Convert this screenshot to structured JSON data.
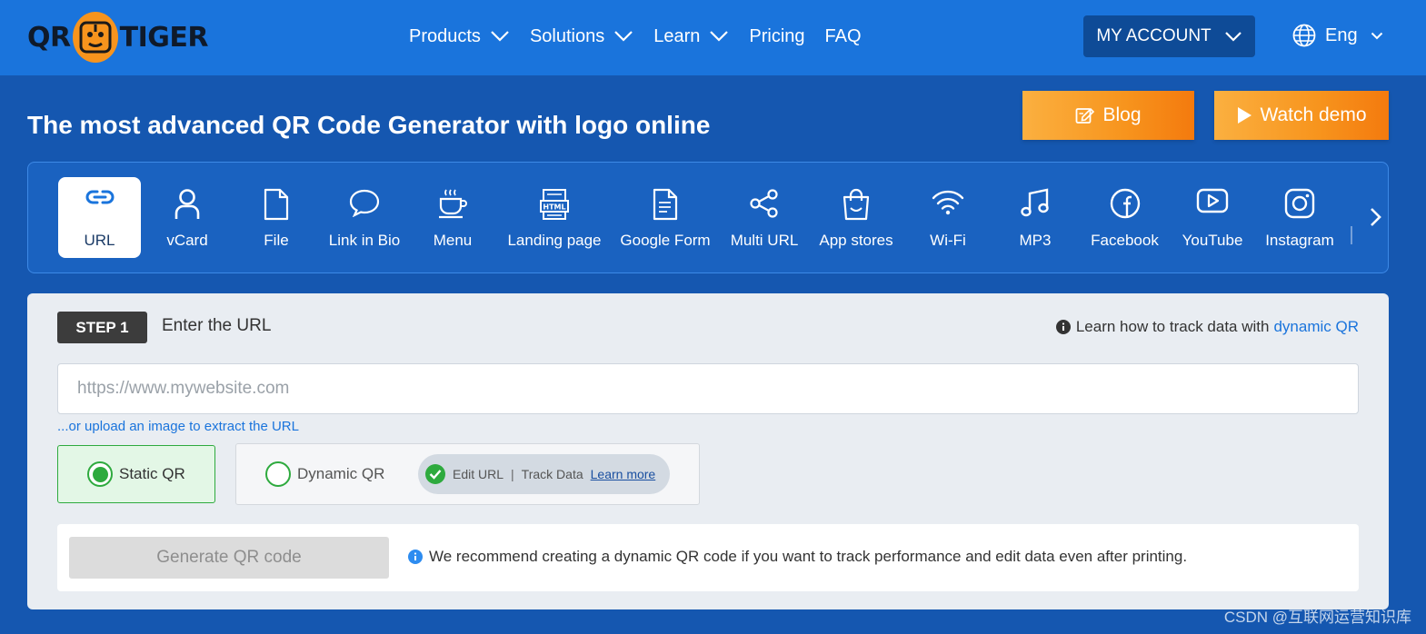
{
  "colors": {
    "nav_bg": "#1a74dc",
    "page_bg": "#1557b0",
    "accent_orange": "#f7941d",
    "success_green": "#2eaa3e"
  },
  "logo": {
    "text_left": "QR",
    "text_right": "TIGER",
    "badge_icon": "tiger-icon"
  },
  "nav": {
    "items": [
      {
        "label": "Products",
        "has_dropdown": true
      },
      {
        "label": "Solutions",
        "has_dropdown": true
      },
      {
        "label": "Learn",
        "has_dropdown": true
      },
      {
        "label": "Pricing",
        "has_dropdown": false
      },
      {
        "label": "FAQ",
        "has_dropdown": false
      }
    ],
    "account_label": "MY ACCOUNT",
    "language_label": "Eng"
  },
  "hero": {
    "title": "The most advanced QR Code Generator with logo online",
    "blog_label": "Blog",
    "demo_label": "Watch demo"
  },
  "qr_types": {
    "items": [
      {
        "label": "URL",
        "icon": "link-icon",
        "active": true
      },
      {
        "label": "vCard",
        "icon": "user-icon"
      },
      {
        "label": "File",
        "icon": "file-icon"
      },
      {
        "label": "Link in Bio",
        "icon": "chat-bubble-icon"
      },
      {
        "label": "Menu",
        "icon": "coffee-cup-icon"
      },
      {
        "label": "Landing page",
        "icon": "html-page-icon"
      },
      {
        "label": "Google Form",
        "icon": "document-icon"
      },
      {
        "label": "Multi URL",
        "icon": "share-icon"
      },
      {
        "label": "App stores",
        "icon": "shopping-bag-icon"
      },
      {
        "label": "Wi-Fi",
        "icon": "wifi-icon"
      },
      {
        "label": "MP3",
        "icon": "music-note-icon"
      },
      {
        "label": "Facebook",
        "icon": "facebook-icon"
      },
      {
        "label": "YouTube",
        "icon": "youtube-icon"
      },
      {
        "label": "Instagram",
        "icon": "instagram-icon"
      }
    ]
  },
  "step": {
    "badge": "STEP 1",
    "label": "Enter the URL",
    "track_text": "Learn how to track data with",
    "track_link": "dynamic QR"
  },
  "url_input": {
    "value": "",
    "placeholder": "https://www.mywebsite.com"
  },
  "upload_link": "...or upload an image to extract the URL",
  "options": {
    "static_label": "Static QR",
    "dynamic_label": "Dynamic QR",
    "dynamic_pill": {
      "edit": "Edit URL",
      "sep": "|",
      "track": "Track Data",
      "learn": "Learn more"
    },
    "selected": "static"
  },
  "generate": {
    "button_label": "Generate QR code",
    "note": "We recommend creating a dynamic QR code if you want to track performance and edit data even after printing."
  },
  "watermark": "CSDN @互联网运营知识库"
}
